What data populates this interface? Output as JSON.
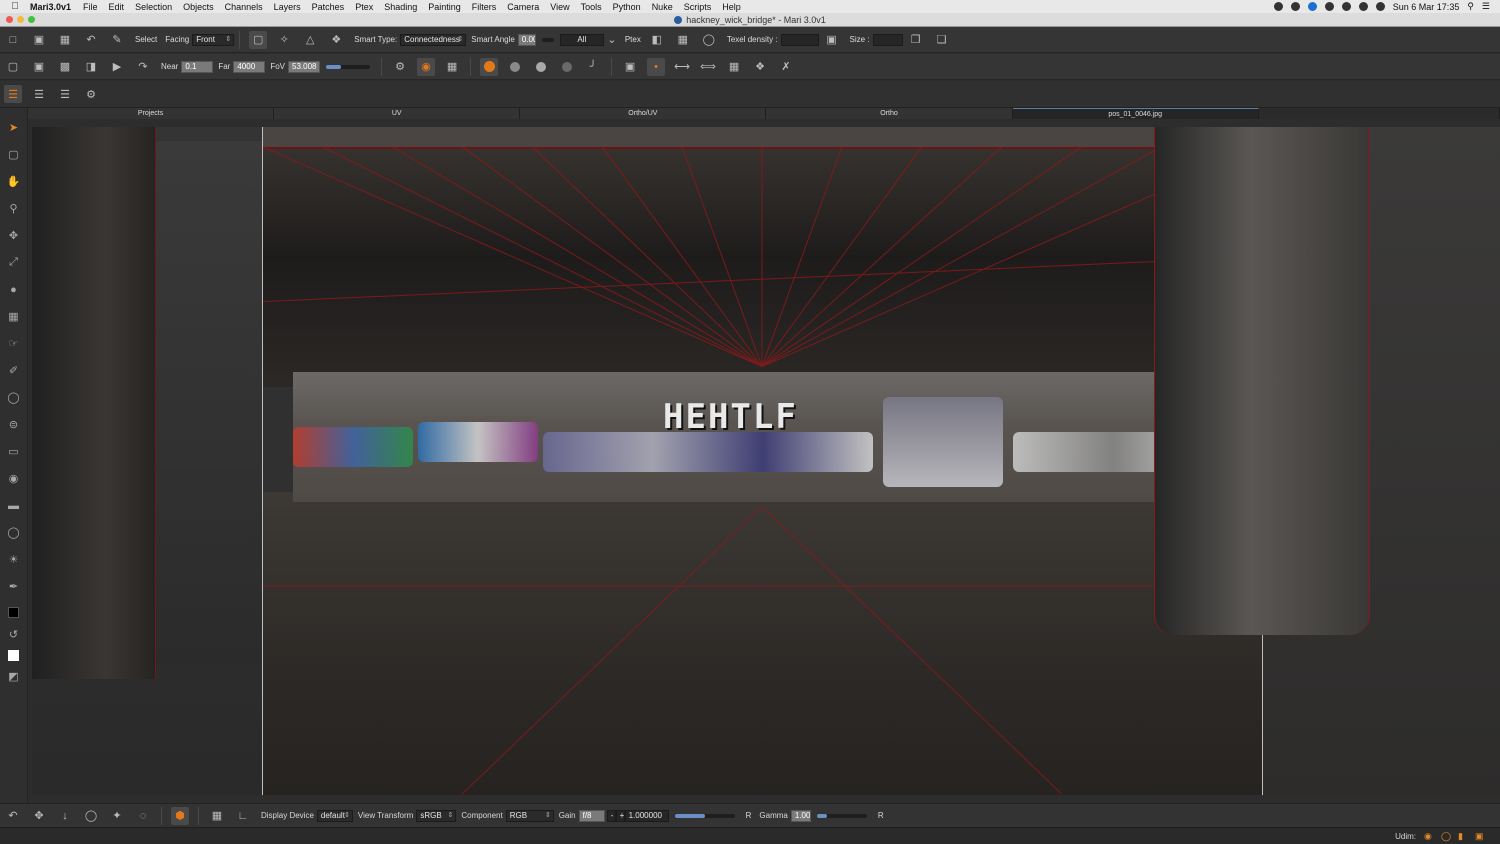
{
  "menubar": {
    "app_name": "Mari3.0v1",
    "menus": [
      "File",
      "Edit",
      "Selection",
      "Objects",
      "Channels",
      "Layers",
      "Patches",
      "Ptex",
      "Shading",
      "Painting",
      "Filters",
      "Camera",
      "View",
      "Tools",
      "Python",
      "Nuke",
      "Scripts",
      "Help"
    ],
    "clock": "Sun 6 Mar  17:35"
  },
  "window": {
    "title": "hackney_wick_bridge* - Mari 3.0v1"
  },
  "toolbar1": {
    "select_label": "Select",
    "facing_label": "Facing",
    "facing_value": "Front",
    "smart_type_label": "Smart Type:",
    "smart_type_value": "Connectedness",
    "smart_angle_label": "Smart Angle",
    "smart_angle_value": "0.00",
    "all_value": "All",
    "ptex_label": "Ptex",
    "texel_density_label": "Texel density :",
    "size_label": "Size :"
  },
  "toolbar2": {
    "near_label": "Near",
    "near_value": "0.1",
    "far_label": "Far",
    "far_value": "4000",
    "fov_label": "FoV",
    "fov_value": "53.008",
    "fov_slider_fraction": 0.35
  },
  "tabs": [
    "Projects",
    "UV",
    "Ortho/UV",
    "Ortho",
    "pos_01_0046.jpg"
  ],
  "active_tab_index": 4,
  "viewport": {
    "graffiti_text": "HEHTLF"
  },
  "bottom": {
    "display_device_label": "Display Device",
    "display_device_value": "default",
    "view_transform_label": "View Transform",
    "view_transform_value": "sRGB",
    "component_label": "Component",
    "component_value": "RGB",
    "gain_label": "Gain",
    "gain_value": "f/8",
    "gain_minus": "-",
    "gain_plus": "+",
    "gain_number": "1.000000",
    "gain_slider_fraction": 0.5,
    "r_label": "R",
    "gamma_label": "Gamma",
    "gamma_value": "1.00",
    "gamma_slider_fraction": 0.2,
    "r_label2": "R"
  },
  "status": {
    "udim_label": "Udim:"
  },
  "colors": {
    "accent_orange": "#e27a1a",
    "wire_red": "#8a1a1a",
    "tab_active_border": "#5d7fae"
  }
}
